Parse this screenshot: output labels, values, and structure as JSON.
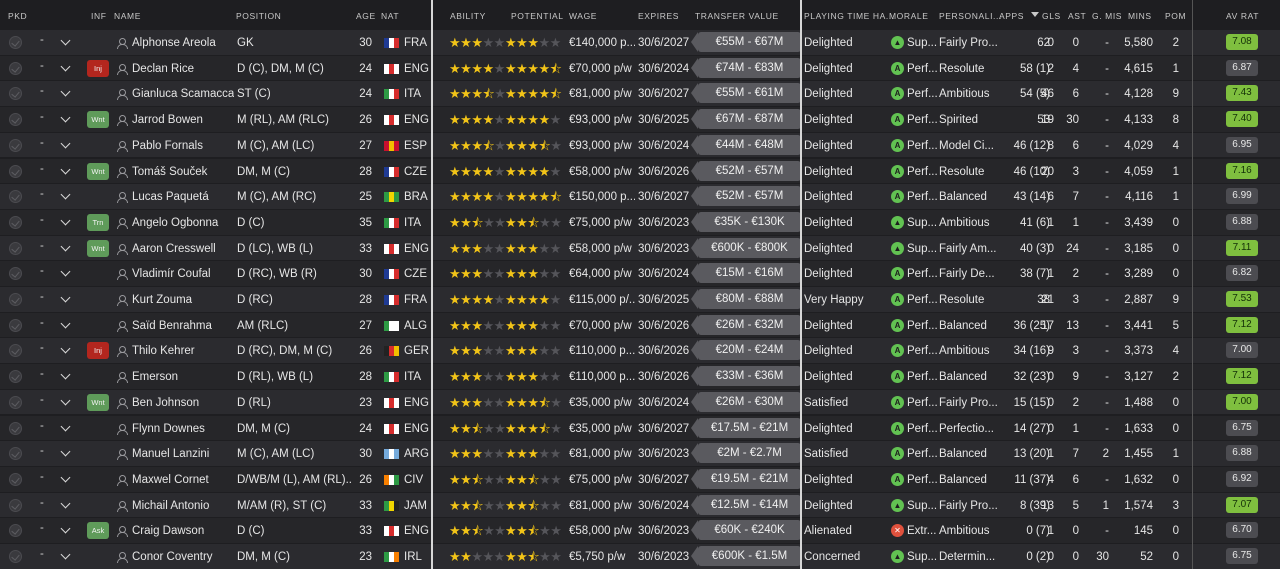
{
  "headers": {
    "pkd": "PKD",
    "inf": "INF",
    "name": "NAME",
    "position": "POSITION",
    "age": "AGE",
    "nat": "NAT",
    "ability": "ABILITY",
    "potential": "POTENTIAL",
    "wage": "WAGE",
    "expires": "EXPIRES",
    "transfer_value": "TRANSFER VALUE",
    "playing_time": "PLAYING TIME HA...",
    "morale": "MORALE",
    "personality": "PERSONALI...",
    "apps": "APPS",
    "gls": "GLS",
    "ast": "AST",
    "gmis": "G. MIS",
    "mins": "MINS",
    "pom": "POM",
    "avrat": "AV RAT"
  },
  "colors": {
    "star_on": "#f2c418",
    "rating_green": "#7fbf3f",
    "rating_grey": "#4c4c51",
    "injury": "#b3261e",
    "want": "#5f9b5a"
  },
  "players": [
    {
      "dash": "-",
      "badge": "",
      "name": "Alphonse Areola",
      "position": "GK",
      "age": "30",
      "nat": "FRA",
      "flag": [
        "#1f3a93",
        "#ffffff",
        "#d62c2c"
      ],
      "ability": 3,
      "potential": 3,
      "wage": "€140,000 p...",
      "expires": "30/6/2027",
      "tv": "€55M - €67M",
      "pt": "Delighted",
      "morale_icon": "up-arrow",
      "morale": "Sup...",
      "pers": "Fairly Pro...",
      "apps": "62",
      "gls": "0",
      "ast": "0",
      "gmis": "-",
      "mins": "5,580",
      "pom": "2",
      "avrat": "7.08",
      "rat_class": "green"
    },
    {
      "dash": "-",
      "badge": "Inj",
      "name": "Declan Rice",
      "position": "D (C), DM, M (C)",
      "age": "24",
      "nat": "ENG",
      "flag": [
        "#ffffff",
        "#d62c2c",
        "#ffffff"
      ],
      "ability": 4,
      "potential": 4.5,
      "wage": "€70,000 p/w",
      "expires": "30/6/2024",
      "tv": "€74M - €83M",
      "pt": "Delighted",
      "morale_icon": "A",
      "morale": "Perf...",
      "pers": "Resolute",
      "apps": "58 (1)",
      "gls": "2",
      "ast": "4",
      "gmis": "-",
      "mins": "4,615",
      "pom": "1",
      "avrat": "6.87",
      "rat_class": "grey"
    },
    {
      "dash": "-",
      "badge": "",
      "name": "Gianluca Scamacca",
      "position": "ST (C)",
      "age": "24",
      "nat": "ITA",
      "flag": [
        "#2d9a44",
        "#ffffff",
        "#d62c2c"
      ],
      "ability": 3.5,
      "potential": 4.5,
      "wage": "€81,000 p/w",
      "expires": "30/6/2027",
      "tv": "€55M - €61M",
      "pt": "Delighted",
      "morale_icon": "A",
      "morale": "Perf...",
      "pers": "Ambitious",
      "apps": "54 (5)",
      "gls": "46",
      "ast": "6",
      "gmis": "-",
      "mins": "4,128",
      "pom": "9",
      "avrat": "7.43",
      "rat_class": "green"
    },
    {
      "dash": "-",
      "badge": "Wnt",
      "name": "Jarrod Bowen",
      "position": "M (RL), AM (RLC)",
      "age": "26",
      "nat": "ENG",
      "flag": [
        "#ffffff",
        "#d62c2c",
        "#ffffff"
      ],
      "ability": 4,
      "potential": 4,
      "wage": "€93,000 p/w",
      "expires": "30/6/2025",
      "tv": "€67M - €87M",
      "pt": "Delighted",
      "morale_icon": "A",
      "morale": "Perf...",
      "pers": "Spirited",
      "apps": "53",
      "gls": "19",
      "ast": "30",
      "gmis": "-",
      "mins": "4,133",
      "pom": "8",
      "avrat": "7.40",
      "rat_class": "green"
    },
    {
      "dash": "-",
      "badge": "",
      "name": "Pablo Fornals",
      "position": "M (C), AM (LC)",
      "age": "27",
      "nat": "ESP",
      "flag": [
        "#c8102e",
        "#f1bf00",
        "#c8102e"
      ],
      "ability": 3.5,
      "potential": 3.5,
      "wage": "€93,000 p/w",
      "expires": "30/6/2024",
      "tv": "€44M - €48M",
      "pt": "Delighted",
      "morale_icon": "A",
      "morale": "Perf...",
      "pers": "Model Ci...",
      "apps": "46 (12)",
      "gls": "8",
      "ast": "6",
      "gmis": "-",
      "mins": "4,029",
      "pom": "4",
      "avrat": "6.95",
      "rat_class": "grey"
    },
    {
      "dash": "-",
      "badge": "Wnt",
      "name": "Tomáš Souček",
      "position": "DM, M (C)",
      "age": "28",
      "nat": "CZE",
      "flag": [
        "#1f3a93",
        "#ffffff",
        "#d62c2c"
      ],
      "ability": 4,
      "potential": 4,
      "wage": "€58,000 p/w",
      "expires": "30/6/2026",
      "tv": "€52M - €57M",
      "pt": "Delighted",
      "morale_icon": "A",
      "morale": "Perf...",
      "pers": "Resolute",
      "apps": "46 (10)",
      "gls": "20",
      "ast": "3",
      "gmis": "-",
      "mins": "4,059",
      "pom": "1",
      "avrat": "7.16",
      "rat_class": "green"
    },
    {
      "dash": "-",
      "badge": "",
      "name": "Lucas Paquetá",
      "position": "M (C), AM (RC)",
      "age": "25",
      "nat": "BRA",
      "flag": [
        "#2d9a44",
        "#f1d600",
        "#2d9a44"
      ],
      "ability": 4,
      "potential": 4.5,
      "wage": "€150,000 p...",
      "expires": "30/6/2027",
      "tv": "€52M - €57M",
      "pt": "Delighted",
      "morale_icon": "A",
      "morale": "Perf...",
      "pers": "Balanced",
      "apps": "43 (14)",
      "gls": "6",
      "ast": "7",
      "gmis": "-",
      "mins": "4,116",
      "pom": "1",
      "avrat": "6.99",
      "rat_class": "grey"
    },
    {
      "dash": "-",
      "badge": "Trn",
      "name": "Angelo Ogbonna",
      "position": "D (C)",
      "age": "35",
      "nat": "ITA",
      "flag": [
        "#2d9a44",
        "#ffffff",
        "#d62c2c"
      ],
      "ability": 2.5,
      "potential": 2.5,
      "wage": "€75,000 p/w",
      "expires": "30/6/2023",
      "tv": "€35K - €130K",
      "pt": "Delighted",
      "morale_icon": "up-arrow",
      "morale": "Sup...",
      "pers": "Ambitious",
      "apps": "41 (6)",
      "gls": "1",
      "ast": "1",
      "gmis": "-",
      "mins": "3,439",
      "pom": "0",
      "avrat": "6.88",
      "rat_class": "grey"
    },
    {
      "dash": "-",
      "badge": "Wnt",
      "name": "Aaron Cresswell",
      "position": "D (LC), WB (L)",
      "age": "33",
      "nat": "ENG",
      "flag": [
        "#ffffff",
        "#d62c2c",
        "#ffffff"
      ],
      "ability": 3,
      "potential": 3,
      "wage": "€58,000 p/w",
      "expires": "30/6/2023",
      "tv": "€600K - €800K",
      "pt": "Delighted",
      "morale_icon": "up-arrow",
      "morale": "Sup...",
      "pers": "Fairly Am...",
      "apps": "40 (3)",
      "gls": "0",
      "ast": "24",
      "gmis": "-",
      "mins": "3,185",
      "pom": "0",
      "avrat": "7.11",
      "rat_class": "green"
    },
    {
      "dash": "-",
      "badge": "",
      "name": "Vladimír Coufal",
      "position": "D (RC), WB (R)",
      "age": "30",
      "nat": "CZE",
      "flag": [
        "#1f3a93",
        "#ffffff",
        "#d62c2c"
      ],
      "ability": 3,
      "potential": 3,
      "wage": "€64,000 p/w",
      "expires": "30/6/2024",
      "tv": "€15M - €16M",
      "pt": "Delighted",
      "morale_icon": "A",
      "morale": "Perf...",
      "pers": "Fairly De...",
      "apps": "38 (7)",
      "gls": "1",
      "ast": "2",
      "gmis": "-",
      "mins": "3,289",
      "pom": "0",
      "avrat": "6.82",
      "rat_class": "grey"
    },
    {
      "dash": "-",
      "badge": "",
      "name": "Kurt Zouma",
      "position": "D (RC)",
      "age": "28",
      "nat": "FRA",
      "flag": [
        "#1f3a93",
        "#ffffff",
        "#d62c2c"
      ],
      "ability": 4,
      "potential": 4,
      "wage": "€115,000 p/...",
      "expires": "30/6/2025",
      "tv": "€80M - €88M",
      "pt": "Very Happy",
      "morale_icon": "A",
      "morale": "Perf...",
      "pers": "Resolute",
      "apps": "38",
      "gls": "21",
      "ast": "3",
      "gmis": "-",
      "mins": "2,887",
      "pom": "9",
      "avrat": "7.53",
      "rat_class": "green"
    },
    {
      "dash": "-",
      "badge": "",
      "name": "Saïd Benrahma",
      "position": "AM (RLC)",
      "age": "27",
      "nat": "ALG",
      "flag": [
        "#2d9a44",
        "#ffffff",
        "#ffffff"
      ],
      "ability": 3,
      "potential": 3,
      "wage": "€70,000 p/w",
      "expires": "30/6/2026",
      "tv": "€26M - €32M",
      "pt": "Delighted",
      "morale_icon": "A",
      "morale": "Perf...",
      "pers": "Balanced",
      "apps": "36 (25)",
      "gls": "17",
      "ast": "13",
      "gmis": "-",
      "mins": "3,441",
      "pom": "5",
      "avrat": "7.12",
      "rat_class": "green"
    },
    {
      "dash": "-",
      "badge": "Inj",
      "name": "Thilo Kehrer",
      "position": "D (RC), DM, M (C)",
      "age": "26",
      "nat": "GER",
      "flag": [
        "#222222",
        "#d62c2c",
        "#f1bf00"
      ],
      "ability": 3,
      "potential": 3,
      "wage": "€110,000 p...",
      "expires": "30/6/2026",
      "tv": "€20M - €24M",
      "pt": "Delighted",
      "morale_icon": "A",
      "morale": "Perf...",
      "pers": "Ambitious",
      "apps": "34 (16)",
      "gls": "9",
      "ast": "3",
      "gmis": "-",
      "mins": "3,373",
      "pom": "4",
      "avrat": "7.00",
      "rat_class": "grey"
    },
    {
      "dash": "-",
      "badge": "",
      "name": "Emerson",
      "position": "D (RL), WB (L)",
      "age": "28",
      "nat": "ITA",
      "flag": [
        "#2d9a44",
        "#ffffff",
        "#d62c2c"
      ],
      "ability": 3,
      "potential": 3,
      "wage": "€110,000 p...",
      "expires": "30/6/2026",
      "tv": "€33M - €36M",
      "pt": "Delighted",
      "morale_icon": "A",
      "morale": "Perf...",
      "pers": "Balanced",
      "apps": "32 (23)",
      "gls": "0",
      "ast": "9",
      "gmis": "-",
      "mins": "3,127",
      "pom": "2",
      "avrat": "7.12",
      "rat_class": "green"
    },
    {
      "dash": "-",
      "badge": "Wnt",
      "name": "Ben Johnson",
      "position": "D (RL)",
      "age": "23",
      "nat": "ENG",
      "flag": [
        "#ffffff",
        "#d62c2c",
        "#ffffff"
      ],
      "ability": 3,
      "potential": 3.5,
      "wage": "€35,000 p/w",
      "expires": "30/6/2024",
      "tv": "€26M - €30M",
      "pt": "Satisfied",
      "morale_icon": "A",
      "morale": "Perf...",
      "pers": "Fairly Pro...",
      "apps": "15 (15)",
      "gls": "0",
      "ast": "2",
      "gmis": "-",
      "mins": "1,488",
      "pom": "0",
      "avrat": "7.00",
      "rat_class": "green"
    },
    {
      "dash": "-",
      "badge": "",
      "name": "Flynn Downes",
      "position": "DM, M (C)",
      "age": "24",
      "nat": "ENG",
      "flag": [
        "#ffffff",
        "#d62c2c",
        "#ffffff"
      ],
      "ability": 2.5,
      "potential": 3.5,
      "wage": "€35,000 p/w",
      "expires": "30/6/2027",
      "tv": "€17.5M - €21M",
      "pt": "Delighted",
      "morale_icon": "A",
      "morale": "Perf...",
      "pers": "Perfectio...",
      "apps": "14 (27)",
      "gls": "0",
      "ast": "1",
      "gmis": "-",
      "mins": "1,633",
      "pom": "0",
      "avrat": "6.75",
      "rat_class": "grey"
    },
    {
      "dash": "-",
      "badge": "",
      "name": "Manuel Lanzini",
      "position": "M (C), AM (LC)",
      "age": "30",
      "nat": "ARG",
      "flag": [
        "#75aadb",
        "#ffffff",
        "#75aadb"
      ],
      "ability": 3,
      "potential": 3,
      "wage": "€81,000 p/w",
      "expires": "30/6/2023",
      "tv": "€2M - €2.7M",
      "pt": "Satisfied",
      "morale_icon": "A",
      "morale": "Perf...",
      "pers": "Balanced",
      "apps": "13 (20)",
      "gls": "1",
      "ast": "7",
      "gmis": "2",
      "mins": "1,455",
      "pom": "1",
      "avrat": "6.88",
      "rat_class": "grey"
    },
    {
      "dash": "-",
      "badge": "",
      "name": "Maxwel Cornet",
      "position": "D/WB/M (L), AM (RL)...",
      "age": "26",
      "nat": "CIV",
      "flag": [
        "#f77f00",
        "#ffffff",
        "#2d9a44"
      ],
      "ability": 2.5,
      "potential": 2.5,
      "wage": "€75,000 p/w",
      "expires": "30/6/2027",
      "tv": "€19.5M - €21M",
      "pt": "Delighted",
      "morale_icon": "A",
      "morale": "Perf...",
      "pers": "Balanced",
      "apps": "11 (37)",
      "gls": "4",
      "ast": "6",
      "gmis": "-",
      "mins": "1,632",
      "pom": "0",
      "avrat": "6.92",
      "rat_class": "grey"
    },
    {
      "dash": "-",
      "badge": "",
      "name": "Michail Antonio",
      "position": "M/AM (R), ST (C)",
      "age": "33",
      "nat": "JAM",
      "flag": [
        "#2d9a44",
        "#f1d600",
        "#222222"
      ],
      "ability": 2.5,
      "potential": 2.5,
      "wage": "€81,000 p/w",
      "expires": "30/6/2024",
      "tv": "€12.5M - €14M",
      "pt": "Delighted",
      "morale_icon": "up-arrow",
      "morale": "Sup...",
      "pers": "Fairly Pro...",
      "apps": "8 (39)",
      "gls": "13",
      "ast": "5",
      "gmis": "1",
      "mins": "1,574",
      "pom": "3",
      "avrat": "7.07",
      "rat_class": "green"
    },
    {
      "dash": "-",
      "badge": "Ask",
      "name": "Craig Dawson",
      "position": "D (C)",
      "age": "33",
      "nat": "ENG",
      "flag": [
        "#ffffff",
        "#d62c2c",
        "#ffffff"
      ],
      "ability": 2.5,
      "potential": 2.5,
      "wage": "€58,000 p/w",
      "expires": "30/6/2023",
      "tv": "€60K - €240K",
      "pt": "Alienated",
      "morale_icon": "down",
      "morale": "Extr...",
      "pers": "Ambitious",
      "apps": "0 (7)",
      "gls": "1",
      "ast": "0",
      "gmis": "-",
      "mins": "145",
      "pom": "0",
      "avrat": "6.70",
      "rat_class": "grey"
    },
    {
      "dash": "-",
      "badge": "",
      "name": "Conor Coventry",
      "position": "DM, M (C)",
      "age": "23",
      "nat": "IRL",
      "flag": [
        "#2d9a44",
        "#ffffff",
        "#f77f00"
      ],
      "ability": 2,
      "potential": 2.5,
      "wage": "€5,750 p/w",
      "expires": "30/6/2023",
      "tv": "€600K - €1.5M",
      "pt": "Concerned",
      "morale_icon": "up-arrow",
      "morale": "Sup...",
      "pers": "Determin...",
      "apps": "0 (2)",
      "gls": "0",
      "ast": "0",
      "gmis": "30",
      "mins": "52",
      "pom": "0",
      "avrat": "6.75",
      "rat_class": "grey"
    }
  ]
}
